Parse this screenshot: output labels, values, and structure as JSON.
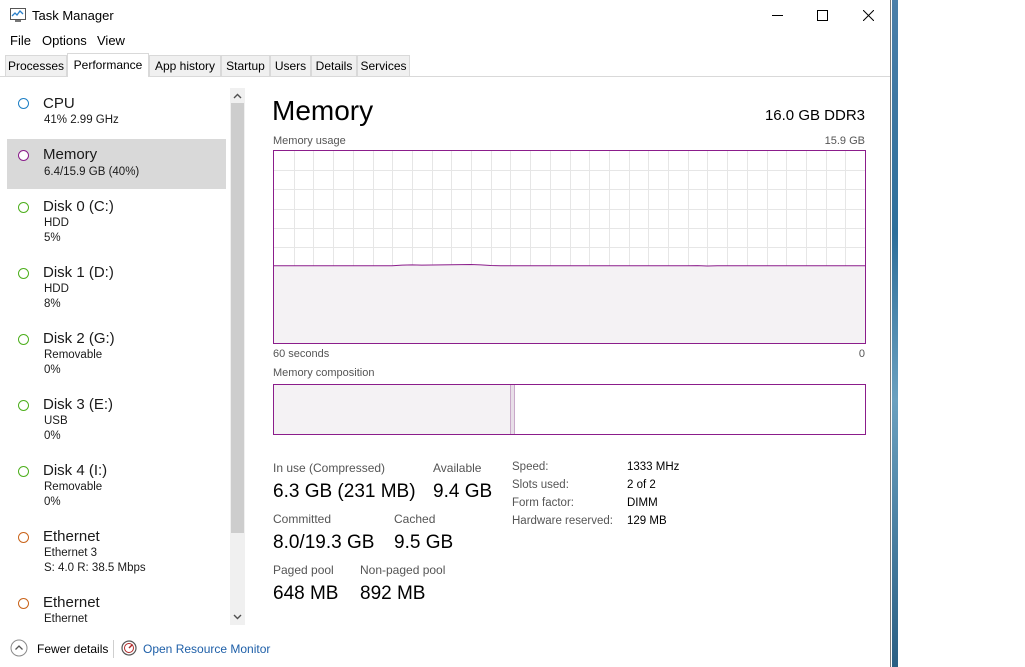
{
  "window": {
    "title": "Task Manager",
    "controls": {
      "minimize": "minimize",
      "maximize": "maximize",
      "close": "close"
    }
  },
  "menu": {
    "items": [
      "File",
      "Options",
      "View"
    ]
  },
  "tabs": [
    "Processes",
    "Performance",
    "App history",
    "Startup",
    "Users",
    "Details",
    "Services"
  ],
  "active_tab": "Performance",
  "sidebar": {
    "items": [
      {
        "title": "CPU",
        "lines": [
          "41%  2.99 GHz"
        ],
        "color": "#1e7fc4",
        "selected": false
      },
      {
        "title": "Memory",
        "lines": [
          "6.4/15.9 GB (40%)"
        ],
        "color": "#8b1d8b",
        "selected": true
      },
      {
        "title": "Disk 0 (C:)",
        "lines": [
          "HDD",
          "5%"
        ],
        "color": "#4daf1d",
        "selected": false
      },
      {
        "title": "Disk 1 (D:)",
        "lines": [
          "HDD",
          "8%"
        ],
        "color": "#4daf1d",
        "selected": false
      },
      {
        "title": "Disk 2 (G:)",
        "lines": [
          "Removable",
          "0%"
        ],
        "color": "#4daf1d",
        "selected": false
      },
      {
        "title": "Disk 3 (E:)",
        "lines": [
          "USB",
          "0%"
        ],
        "color": "#4daf1d",
        "selected": false
      },
      {
        "title": "Disk 4 (I:)",
        "lines": [
          "Removable",
          "0%"
        ],
        "color": "#4daf1d",
        "selected": false
      },
      {
        "title": "Ethernet",
        "lines": [
          "Ethernet 3",
          "S: 4.0  R: 38.5 Mbps"
        ],
        "color": "#c9641b",
        "selected": false
      },
      {
        "title": "Ethernet",
        "lines": [
          "Ethernet"
        ],
        "color": "#c9641b",
        "selected": false
      }
    ]
  },
  "main": {
    "title": "Memory",
    "spec": "16.0 GB DDR3",
    "usage_label": "Memory usage",
    "usage_max": "15.9 GB",
    "time_left": "60 seconds",
    "time_right": "0",
    "composition_label": "Memory composition",
    "stats": {
      "in_use_label": "In use (Compressed)",
      "in_use_value": "6.3 GB (231 MB)",
      "available_label": "Available",
      "available_value": "9.4 GB",
      "committed_label": "Committed",
      "committed_value": "8.0/19.3 GB",
      "cached_label": "Cached",
      "cached_value": "9.5 GB",
      "paged_label": "Paged pool",
      "paged_value": "648 MB",
      "nonpaged_label": "Non-paged pool",
      "nonpaged_value": "892 MB"
    },
    "details": [
      {
        "label": "Speed:",
        "value": "1333 MHz"
      },
      {
        "label": "Slots used:",
        "value": "2 of 2"
      },
      {
        "label": "Form factor:",
        "value": "DIMM"
      },
      {
        "label": "Hardware reserved:",
        "value": "129 MB"
      }
    ]
  },
  "usage_graph": {
    "max_gb": 15.9,
    "series_gb": [
      6.4,
      6.4,
      6.4,
      6.4,
      6.4,
      6.4,
      6.4,
      6.4,
      6.4,
      6.4,
      6.4,
      6.4,
      6.4,
      6.45,
      6.47,
      6.45,
      6.46,
      6.47,
      6.48,
      6.49,
      6.5,
      6.47,
      6.42,
      6.4,
      6.4,
      6.4,
      6.4,
      6.4,
      6.4,
      6.4,
      6.4,
      6.4,
      6.4,
      6.4,
      6.4,
      6.4,
      6.4,
      6.4,
      6.4,
      6.4,
      6.4,
      6.4,
      6.4,
      6.41,
      6.38,
      6.4,
      6.4,
      6.4,
      6.4,
      6.4,
      6.4,
      6.4,
      6.4,
      6.4,
      6.4,
      6.4,
      6.4,
      6.4,
      6.4,
      6.4,
      6.4
    ]
  },
  "composition": {
    "in_use_fraction": 0.4,
    "modified_fraction": 0.005
  },
  "footer": {
    "fewer_details": "Fewer details",
    "open_resource_monitor": "Open Resource Monitor"
  },
  "colors": {
    "memory": "#8b1d8b",
    "memory_fill": "#f4f2f4",
    "grid": "#e6e6e6",
    "link": "#1e5fa8"
  }
}
